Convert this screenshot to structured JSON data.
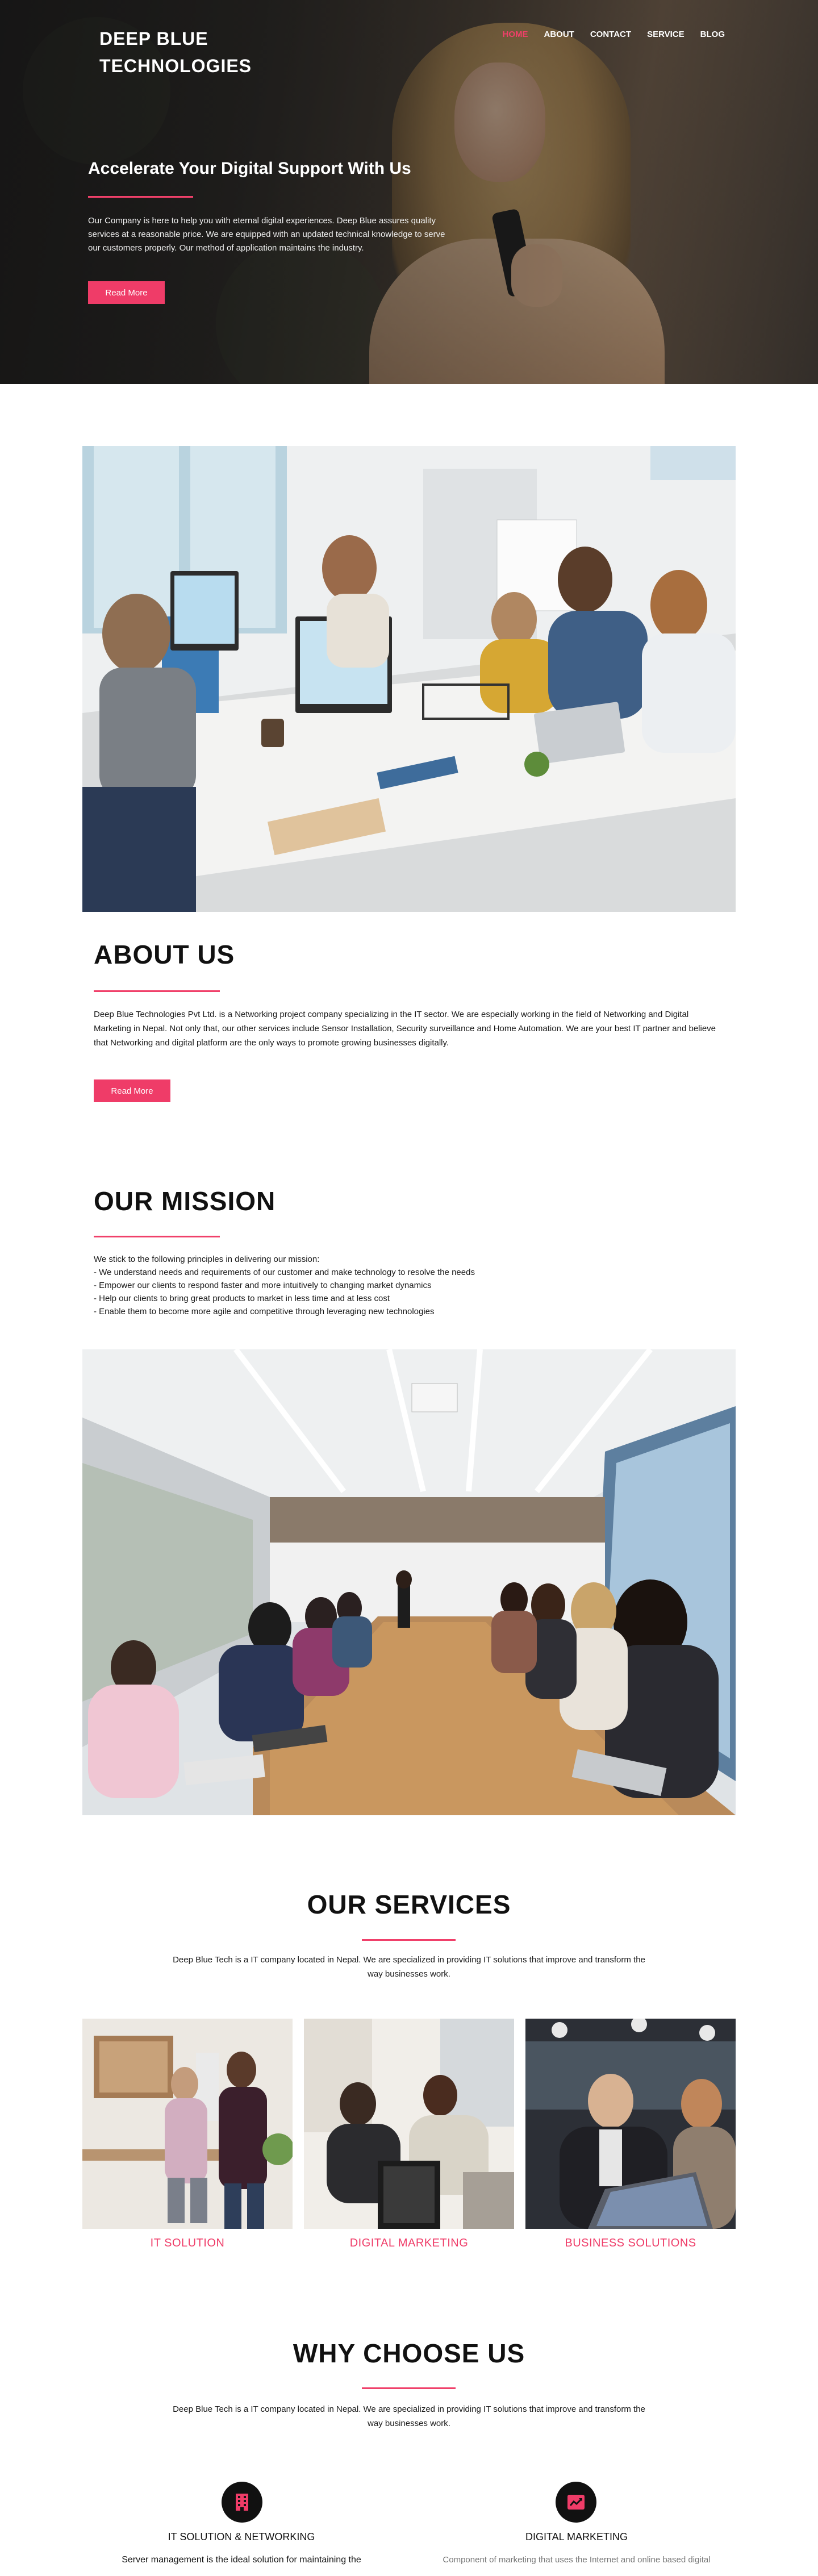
{
  "header": {
    "brand": "DEEP BLUE TECHNOLOGIES",
    "nav": [
      {
        "label": "HOME",
        "active": true
      },
      {
        "label": "ABOUT",
        "active": false
      },
      {
        "label": "CONTACT",
        "active": false
      },
      {
        "label": "SERVICE",
        "active": false
      },
      {
        "label": "BLOG",
        "active": false
      }
    ]
  },
  "hero": {
    "title": "Accelerate Your Digital Support With Us",
    "text": "Our Company is here to help you with eternal digital experiences. Deep Blue assures quality services at a reasonable price. We are equipped with an updated technical knowledge to serve our customers properly. Our method of application maintains the industry.",
    "button": "Read More"
  },
  "about": {
    "title": "ABOUT US",
    "text": "Deep Blue Technologies Pvt Ltd. is a Networking project company specializing in the IT sector. We are especially working in the field of Networking and Digital Marketing in Nepal. Not only that, our other services include Sensor Installation, Security surveillance and Home Automation. We are your best IT partner and believe that Networking and digital platform are the only ways to promote growing businesses digitally.",
    "button": "Read More"
  },
  "mission": {
    "title": "OUR MISSION",
    "intro": "We stick to the following principles in delivering our mission:",
    "points": [
      "- We understand needs and requirements of our customer and make technology to resolve the needs",
      "- Empower our clients to respond faster and more intuitively to changing market dynamics",
      "- Help our clients to bring great products to market in less time and at less cost",
      "- Enable them to become more agile and competitive through leveraging new technologies"
    ]
  },
  "services": {
    "title": "OUR SERVICES",
    "text": "Deep Blue Tech is a IT company located in Nepal. We are specialized in providing IT solutions that improve and transform the way businesses work.",
    "items": [
      {
        "label": "IT SOLUTION"
      },
      {
        "label": "DIGITAL MARKETING"
      },
      {
        "label": "BUSINESS SOLUTIONS"
      }
    ]
  },
  "why": {
    "title": "WHY CHOOSE US",
    "text": "Deep Blue Tech is a IT company located in Nepal. We are specialized in providing IT solutions that improve and transform the way businesses work.",
    "items": [
      {
        "title": "IT SOLUTION & NETWORKING",
        "desc": "Server management is the ideal solution for maintaining the",
        "icon": "building-icon"
      },
      {
        "title": "DIGITAL MARKETING",
        "desc": "Component of marketing that uses the Internet and online based digital",
        "icon": "trend-chart-icon"
      }
    ]
  },
  "colors": {
    "accent": "#ef3c68",
    "text": "#111111",
    "background": "#ffffff"
  }
}
